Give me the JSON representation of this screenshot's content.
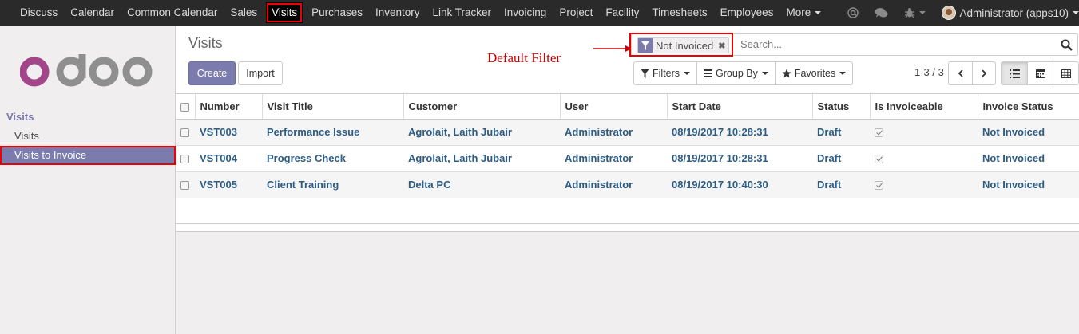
{
  "menu": {
    "items": [
      {
        "label": "Discuss",
        "active": false
      },
      {
        "label": "Calendar",
        "active": false
      },
      {
        "label": "Common Calendar",
        "active": false
      },
      {
        "label": "Sales",
        "active": false
      },
      {
        "label": "Visits",
        "active": true
      },
      {
        "label": "Purchases",
        "active": false
      },
      {
        "label": "Inventory",
        "active": false
      },
      {
        "label": "Link Tracker",
        "active": false
      },
      {
        "label": "Invoicing",
        "active": false
      },
      {
        "label": "Project",
        "active": false
      },
      {
        "label": "Facility",
        "active": false
      },
      {
        "label": "Timesheets",
        "active": false
      },
      {
        "label": "Employees",
        "active": false
      }
    ],
    "more_label": "More",
    "user_label": "Administrator (apps10)"
  },
  "sidebar": {
    "logo_text": "odoo",
    "heading": "Visits",
    "items": [
      {
        "label": "Visits",
        "selected": false
      },
      {
        "label": "Visits to Invoice",
        "selected": true
      }
    ]
  },
  "control_panel": {
    "breadcrumb": "Visits",
    "create_label": "Create",
    "import_label": "Import",
    "search": {
      "facet_value": "Not Invoiced",
      "placeholder": "Search..."
    },
    "annotation": "Default Filter",
    "filters_label": "Filters",
    "groupby_label": "Group By",
    "favorites_label": "Favorites",
    "pager": "1-3 / 3"
  },
  "table": {
    "columns": [
      "Number",
      "Visit Title",
      "Customer",
      "User",
      "Start Date",
      "Status",
      "Is Invoiceable",
      "Invoice Status"
    ],
    "rows": [
      {
        "number": "VST003",
        "title": "Performance Issue",
        "customer": "Agrolait, Laith Jubair",
        "user": "Administrator",
        "start": "08/19/2017 10:28:31",
        "status": "Draft",
        "invoiceable": true,
        "invoice_status": "Not Invoiced"
      },
      {
        "number": "VST004",
        "title": "Progress Check",
        "customer": "Agrolait, Laith Jubair",
        "user": "Administrator",
        "start": "08/19/2017 10:28:31",
        "status": "Draft",
        "invoiceable": true,
        "invoice_status": "Not Invoiced"
      },
      {
        "number": "VST005",
        "title": "Client Training",
        "customer": "Delta PC",
        "user": "Administrator",
        "start": "08/19/2017 10:40:30",
        "status": "Draft",
        "invoiceable": true,
        "invoice_status": "Not Invoiced"
      }
    ]
  },
  "colors": {
    "brand": "#7c7bad",
    "navbar": "#2a2a2a",
    "link": "#2d5c84",
    "highlight": "#e00000"
  }
}
